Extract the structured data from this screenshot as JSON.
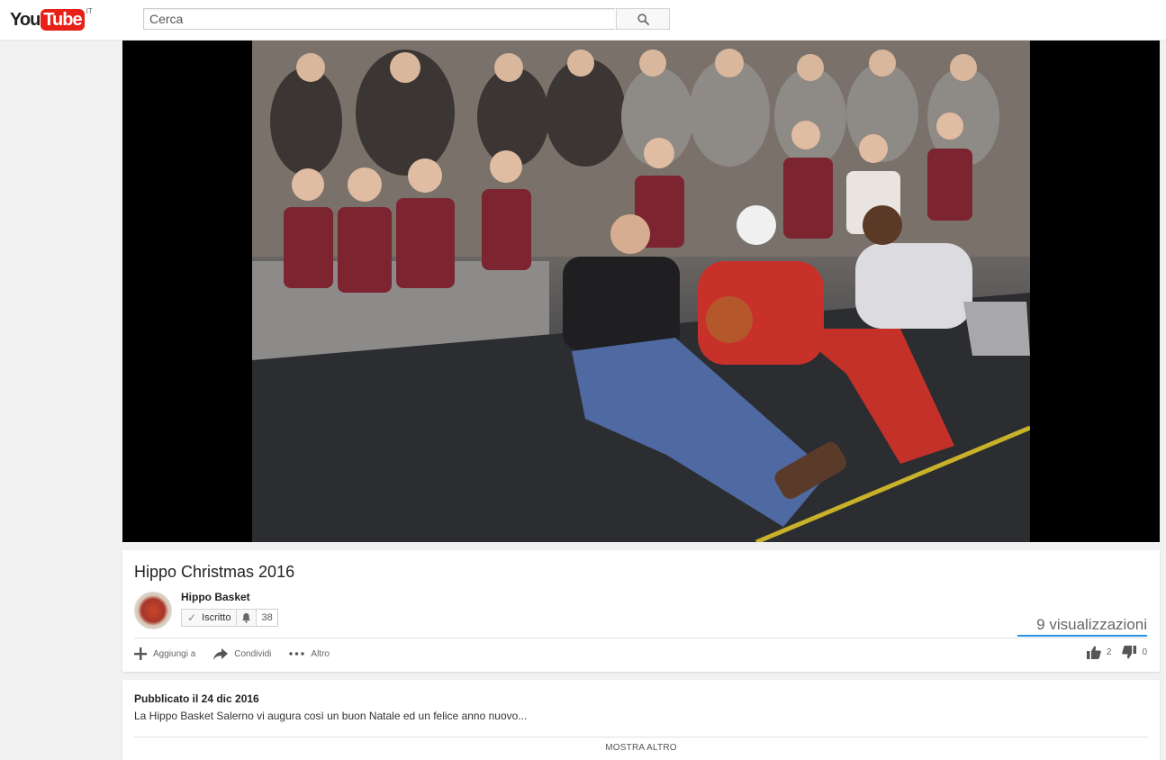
{
  "masthead": {
    "logo_you": "You",
    "logo_tube": "Tube",
    "logo_country": "IT",
    "search_placeholder": "Cerca"
  },
  "video": {
    "title": "Hippo Christmas 2016",
    "views": "9 visualizzazioni"
  },
  "channel": {
    "name": "Hippo Basket",
    "subscribe_label": "Iscritto",
    "subscriber_count": "38"
  },
  "actions": {
    "add_to": "Aggiungi a",
    "share": "Condividi",
    "more": "Altro",
    "likes": "2",
    "dislikes": "0"
  },
  "description": {
    "published": "Pubblicato il 24 dic 2016",
    "text": "La Hippo Basket Salerno vi augura così un buon Natale ed un felice anno nuovo...",
    "show_more": "MOSTRA ALTRO"
  },
  "colors": {
    "brand_red": "#e62117",
    "sentiment_blue": "#2793e6"
  }
}
